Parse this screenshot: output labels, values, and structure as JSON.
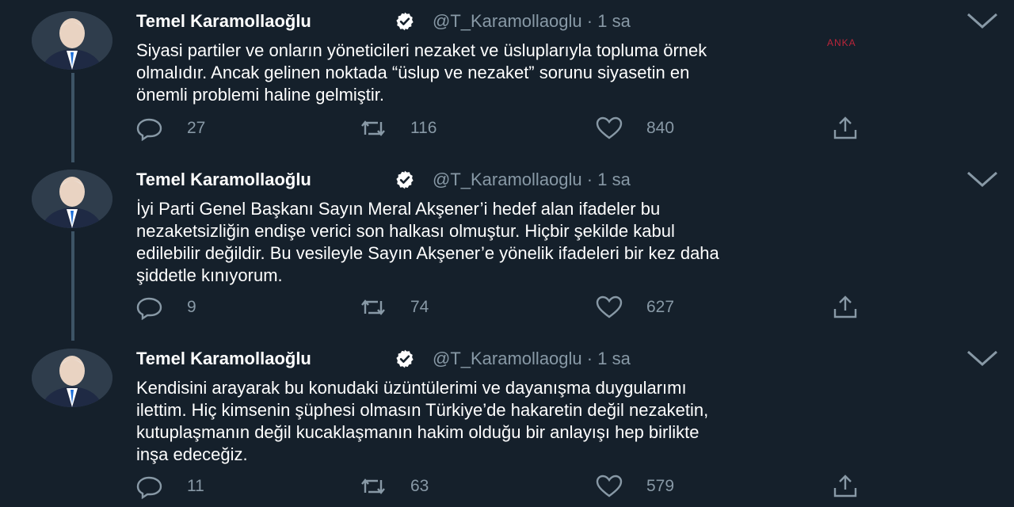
{
  "colors": {
    "background": "#15202b",
    "text": "#ffffff",
    "muted": "#8899a6",
    "verified": "#ffffff",
    "thread_line": "#3d5466"
  },
  "watermark": "ANKA",
  "tweets": [
    {
      "author_name": "Temel Karamollaoğlu",
      "handle": "@T_Karamollaoglu",
      "time": "· 1 sa",
      "text": "Siyasi partiler ve onların yöneticileri nezaket ve üsluplarıyla topluma örnek\nolmalıdır. Ancak gelinen noktada “üslup ve nezaket” sorunu siyasetin en\nönemli problemi haline gelmiştir.",
      "replies": "27",
      "retweets": "116",
      "likes": "840"
    },
    {
      "author_name": "Temel Karamollaoğlu",
      "handle": "@T_Karamollaoglu",
      "time": "· 1 sa",
      "text": "İyi Parti Genel Başkanı Sayın Meral Akşener’i hedef alan ifadeler bu\nnezaketsizliğin endişe verici son halkası olmuştur. Hiçbir şekilde kabul\nedilebilir değildir. Bu vesileyle Sayın Akşener’e yönelik ifadeleri bir kez daha\nşiddetle kınıyorum.",
      "replies": "9",
      "retweets": "74",
      "likes": "627"
    },
    {
      "author_name": "Temel Karamollaoğlu",
      "handle": "@T_Karamollaoglu",
      "time": "· 1 sa",
      "text": "Kendisini arayarak bu konudaki üzüntülerimi ve dayanışma duygularımı\nilettim. Hiç kimsenin şüphesi olmasın Türkiye’de hakaretin değil nezaketin,\nkutuplaşmanın değil kucaklaşmanın hakim olduğu bir anlayışı hep birlikte\ninşa edeceğiz.",
      "replies": "11",
      "retweets": "63",
      "likes": "579"
    }
  ]
}
